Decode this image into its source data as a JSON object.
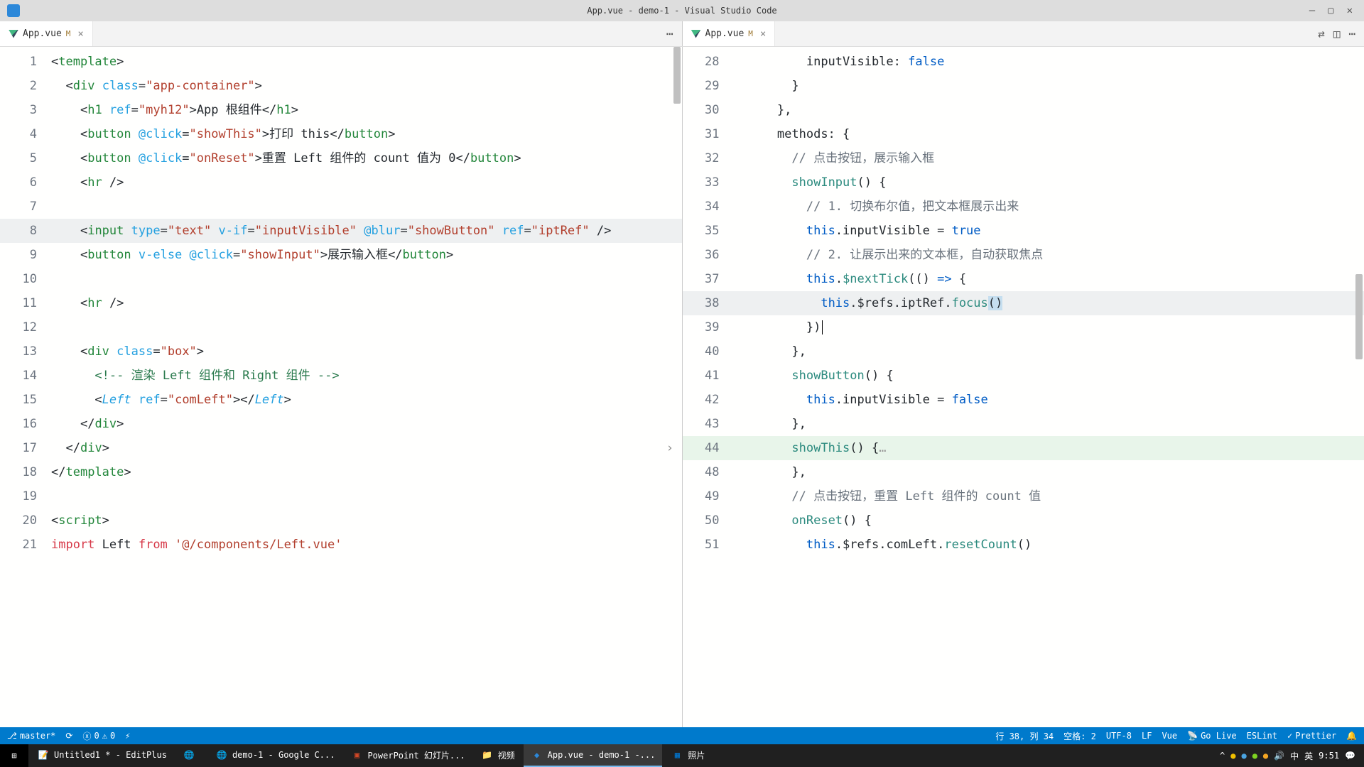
{
  "titlebar": {
    "title": "App.vue - demo-1 - Visual Studio Code"
  },
  "tabs": {
    "left": {
      "name": "App.vue",
      "modified": "M"
    },
    "right": {
      "name": "App.vue",
      "modified": "M"
    }
  },
  "statusbar": {
    "branch": "master*",
    "errors": "0",
    "warnings": "0",
    "ln_col": "行 38, 列 34",
    "spaces": "空格: 2",
    "encoding": "UTF-8",
    "eol": "LF",
    "lang": "Vue",
    "golive": "Go Live",
    "eslint": "ESLint",
    "prettier": "Prettier"
  },
  "taskbar": {
    "items": [
      "Untitled1 * - EditPlus",
      "demo-1 - Google C...",
      "PowerPoint 幻灯片...",
      "视频",
      "App.vue - demo-1 -...",
      "照片"
    ],
    "time": "9:51",
    "ime1": "中",
    "ime2": "英"
  },
  "left_code": [
    {
      "n": 1,
      "html": "<span class='punct'>&lt;</span><span class='tag'>template</span><span class='punct'>&gt;</span>"
    },
    {
      "n": 2,
      "html": "  <span class='punct'>&lt;</span><span class='tag'>div</span> <span class='attr'>class</span>=<span class='string'>\"app-container\"</span><span class='punct'>&gt;</span>"
    },
    {
      "n": 3,
      "html": "    <span class='punct'>&lt;</span><span class='tag'>h1</span> <span class='attr'>ref</span>=<span class='string'>\"myh12\"</span><span class='punct'>&gt;</span>App 根组件<span class='punct'>&lt;/</span><span class='tag'>h1</span><span class='punct'>&gt;</span>"
    },
    {
      "n": 4,
      "html": "    <span class='punct'>&lt;</span><span class='tag'>button</span> <span class='attr'>@click</span>=<span class='string'>\"showThis\"</span><span class='punct'>&gt;</span>打印 this<span class='punct'>&lt;/</span><span class='tag'>button</span><span class='punct'>&gt;</span>"
    },
    {
      "n": 5,
      "html": "    <span class='punct'>&lt;</span><span class='tag'>button</span> <span class='attr'>@click</span>=<span class='string'>\"onReset\"</span><span class='punct'>&gt;</span>重置 Left 组件的 count 值为 0<span class='punct'>&lt;/</span><span class='tag'>button</span><span class='punct'>&gt;</span>"
    },
    {
      "n": 6,
      "html": "    <span class='punct'>&lt;</span><span class='tag'>hr</span> <span class='punct'>/&gt;</span>"
    },
    {
      "n": 7,
      "html": ""
    },
    {
      "n": 8,
      "hl": true,
      "html": "    <span class='punct'>&lt;</span><span class='tag'>input</span> <span class='attr'>type</span>=<span class='string'>\"text\"</span> <span class='attr'>v-if</span>=<span class='string'>\"inputVisible\"</span> <span class='attr'>@blur</span>=<span class='string'>\"showButton\"</span> <span class='attr'>ref</span>=<span class='string'>\"iptRef\"</span> <span class='punct'>/&gt;</span>"
    },
    {
      "n": 9,
      "html": "    <span class='punct'>&lt;</span><span class='tag'>button</span> <span class='attr'>v-else</span> <span class='attr'>@click</span>=<span class='string'>\"showInput\"</span><span class='punct'>&gt;</span>展示输入框<span class='punct'>&lt;/</span><span class='tag'>button</span><span class='punct'>&gt;</span>"
    },
    {
      "n": 10,
      "html": ""
    },
    {
      "n": 11,
      "html": "    <span class='punct'>&lt;</span><span class='tag'>hr</span> <span class='punct'>/&gt;</span>"
    },
    {
      "n": 12,
      "html": ""
    },
    {
      "n": 13,
      "html": "    <span class='punct'>&lt;</span><span class='tag'>div</span> <span class='attr'>class</span>=<span class='string'>\"box\"</span><span class='punct'>&gt;</span>"
    },
    {
      "n": 14,
      "html": "      <span class='cmt'>&lt;!-- 渲染 Left 组件和 Right 组件 --&gt;</span>"
    },
    {
      "n": 15,
      "html": "      <span class='punct'>&lt;</span><span class='name'>Left</span> <span class='attr'>ref</span>=<span class='string'>\"comLeft\"</span><span class='punct'>&gt;&lt;/</span><span class='name'>Left</span><span class='punct'>&gt;</span>"
    },
    {
      "n": 16,
      "html": "    <span class='punct'>&lt;/</span><span class='tag'>div</span><span class='punct'>&gt;</span>"
    },
    {
      "n": 17,
      "html": "  <span class='punct'>&lt;/</span><span class='tag'>div</span><span class='punct'>&gt;</span>"
    },
    {
      "n": 18,
      "html": "<span class='punct'>&lt;/</span><span class='tag'>template</span><span class='punct'>&gt;</span>"
    },
    {
      "n": 19,
      "html": ""
    },
    {
      "n": 20,
      "html": "<span class='punct'>&lt;</span><span class='tag'>script</span><span class='punct'>&gt;</span>"
    },
    {
      "n": 21,
      "html": "<span class='imp'>import</span> Left <span class='imp'>from</span> <span class='string'>'@/components/Left.vue'</span>"
    }
  ],
  "right_code": [
    {
      "n": 28,
      "html": "          inputVisible: <span class='bool'>false</span>"
    },
    {
      "n": 29,
      "html": "        }"
    },
    {
      "n": 30,
      "html": "      },"
    },
    {
      "n": 31,
      "html": "      methods: {"
    },
    {
      "n": 32,
      "html": "        <span class='cmtjs'>// 点击按钮，展示输入框</span>"
    },
    {
      "n": 33,
      "html": "        <span class='func'>showInput</span>() {"
    },
    {
      "n": 34,
      "html": "          <span class='cmtjs'>// 1. 切换布尔值，把文本框展示出来</span>"
    },
    {
      "n": 35,
      "html": "          <span class='bool'>this</span>.inputVisible = <span class='bool'>true</span>"
    },
    {
      "n": 36,
      "html": "          <span class='cmtjs'>// 2. 让展示出来的文本框，自动获取焦点</span>"
    },
    {
      "n": 37,
      "html": "          <span class='bool'>this</span>.<span class='func'>$nextTick</span>(() <span class='bool'>=&gt;</span> {"
    },
    {
      "n": 38,
      "hl": true,
      "html": "            <span class='bool'>this</span>.$refs.iptRef.<span class='func'>focus</span><span class='sel'>()</span>"
    },
    {
      "n": 39,
      "cursor": true,
      "html": "          })"
    },
    {
      "n": 40,
      "html": "        },"
    },
    {
      "n": 41,
      "html": "        <span class='func'>showButton</span>() {"
    },
    {
      "n": 42,
      "html": "          <span class='bool'>this</span>.inputVisible = <span class='bool'>false</span>"
    },
    {
      "n": 43,
      "html": "        },"
    },
    {
      "n": 44,
      "hl2": true,
      "fold": true,
      "html": "        <span class='func'>showThis</span>() {<span class='fold'>…</span>"
    },
    {
      "n": 48,
      "html": "        },"
    },
    {
      "n": 49,
      "html": "        <span class='cmtjs'>// 点击按钮，重置 Left 组件的 count 值</span>"
    },
    {
      "n": 50,
      "html": "        <span class='func'>onReset</span>() {"
    },
    {
      "n": 51,
      "html": "          <span class='bool'>this</span>.$refs.comLeft.<span class='func'>resetCount</span>()"
    }
  ]
}
